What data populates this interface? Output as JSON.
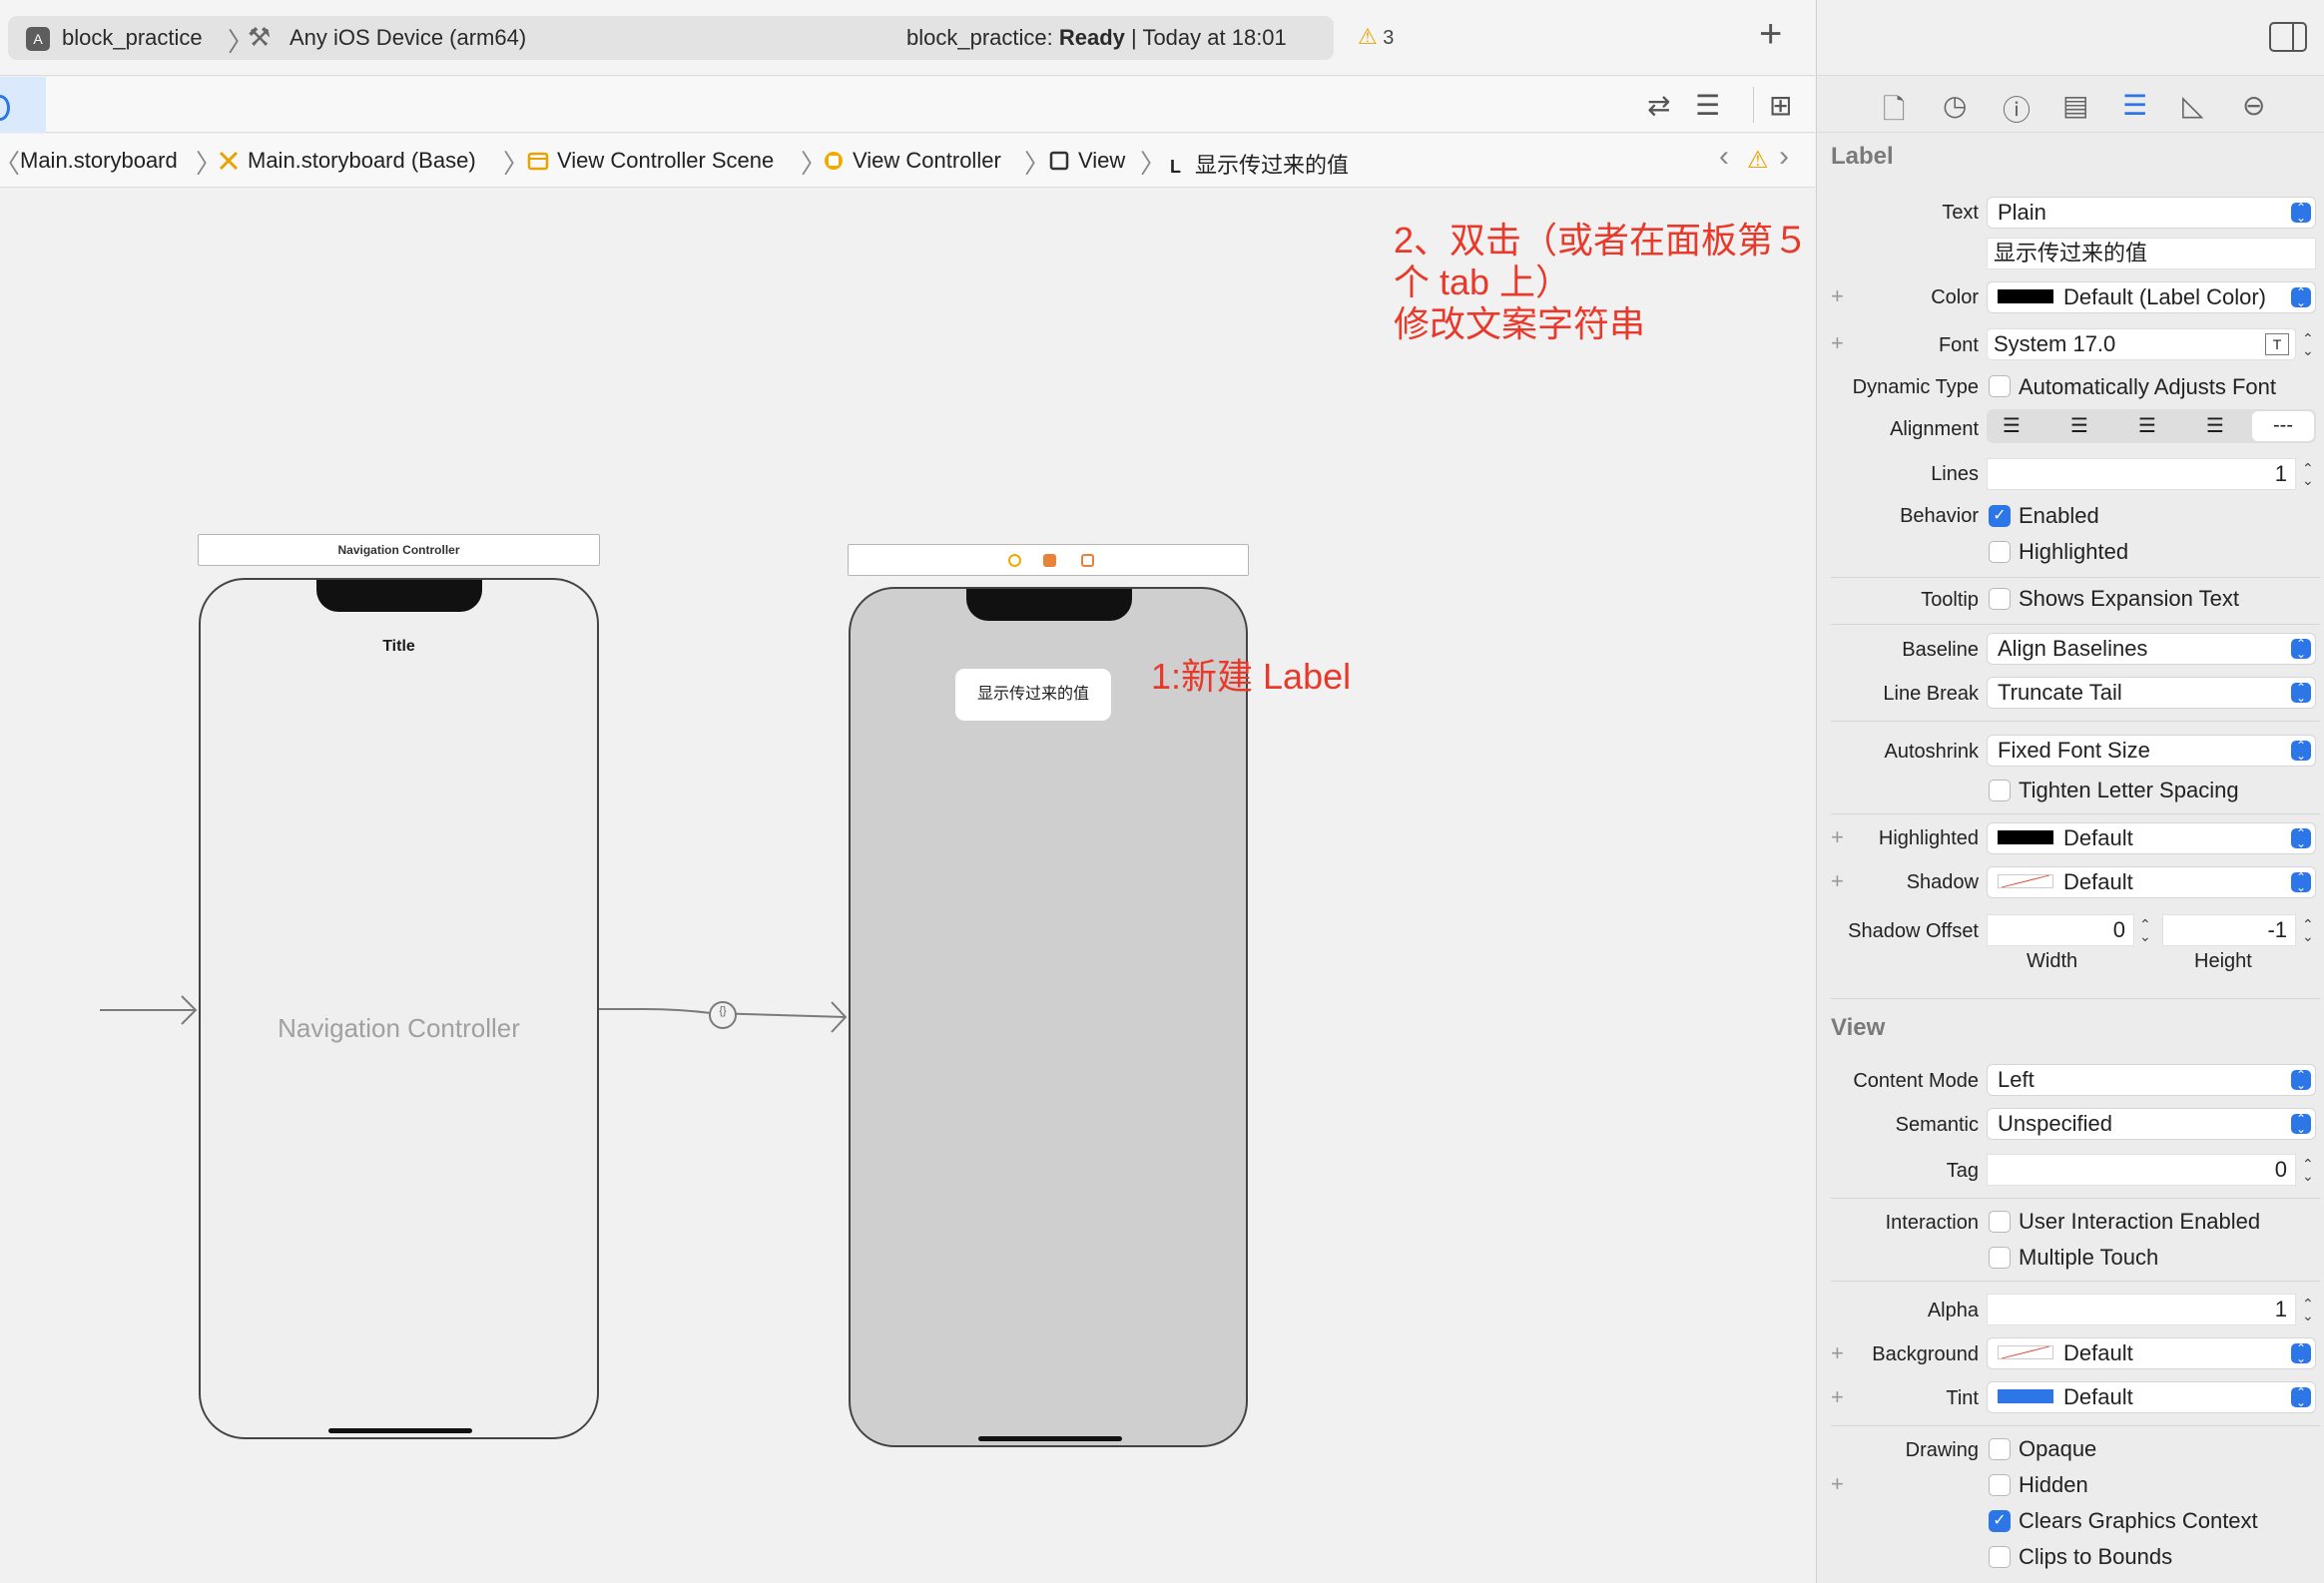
{
  "toolbar": {
    "project": "block_practice",
    "device": "Any iOS Device (arm64)",
    "status_prefix": "block_practice: ",
    "status_state": "Ready",
    "status_time": " | Today at 18:01",
    "warning_count": "3"
  },
  "breadcrumb": [
    "Main.storyboard",
    "Main.storyboard (Base)",
    "View Controller Scene",
    "View Controller",
    "View",
    "显示传过来的值"
  ],
  "breadcrumb_label_glyph": "L",
  "canvas": {
    "nav_scene_title": "Navigation Controller",
    "nav_bar_title": "Title",
    "nav_placeholder": "Navigation Controller",
    "label_text": "显示传过来的值",
    "segue_glyph": "{}",
    "annotation_1": "1:新建 Label",
    "annotation_2_line1": "2、双击（或者在面板第５个 tab 上）",
    "annotation_2_line2": "修改文案字符串"
  },
  "inspector": {
    "label_section": "Label",
    "text_label": "Text",
    "text_type": "Plain",
    "text_value": "显示传过来的值",
    "color_label": "Color",
    "color_value": "Default (Label Color)",
    "font_label": "Font",
    "font_value": "System 17.0",
    "dynamic_type_label": "Dynamic Type",
    "dynamic_type_option": "Automatically Adjusts Font",
    "alignment_label": "Alignment",
    "alignment_natural": "---",
    "lines_label": "Lines",
    "lines_value": "1",
    "behavior_label": "Behavior",
    "behavior_enabled": "Enabled",
    "behavior_highlighted": "Highlighted",
    "tooltip_label": "Tooltip",
    "tooltip_option": "Shows Expansion Text",
    "baseline_label": "Baseline",
    "baseline_value": "Align Baselines",
    "linebreak_label": "Line Break",
    "linebreak_value": "Truncate Tail",
    "autoshrink_label": "Autoshrink",
    "autoshrink_value": "Fixed Font Size",
    "tighten_option": "Tighten Letter Spacing",
    "highlighted_label": "Highlighted",
    "highlighted_value": "Default",
    "shadow_label": "Shadow",
    "shadow_value": "Default",
    "shadow_offset_label": "Shadow Offset",
    "shadow_width": "0",
    "shadow_height": "-1",
    "width_label": "Width",
    "height_label": "Height",
    "view_section": "View",
    "content_mode_label": "Content Mode",
    "content_mode_value": "Left",
    "semantic_label": "Semantic",
    "semantic_value": "Unspecified",
    "tag_label": "Tag",
    "tag_value": "0",
    "interaction_label": "Interaction",
    "interaction_user": "User Interaction Enabled",
    "interaction_multi": "Multiple Touch",
    "alpha_label": "Alpha",
    "alpha_value": "1",
    "background_label": "Background",
    "background_value": "Default",
    "tint_label": "Tint",
    "tint_value": "Default",
    "drawing_label": "Drawing",
    "drawing_opaque": "Opaque",
    "drawing_hidden": "Hidden",
    "drawing_clears": "Clears Graphics Context",
    "drawing_clips": "Clips to Bounds"
  },
  "colors": {
    "accent": "#2c76e8",
    "annotation": "#e8392b",
    "warning": "#e8a300",
    "tint_swatch": "#2c76e8"
  }
}
